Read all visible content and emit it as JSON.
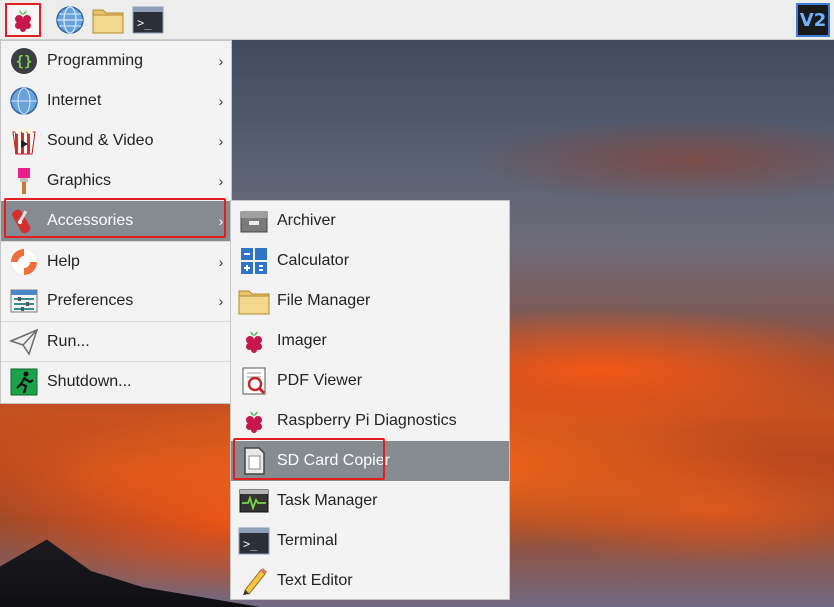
{
  "taskbar": {
    "menu_icon": "raspberry-pi-icon",
    "web_icon": "globe-icon",
    "files_icon": "folder-icon",
    "terminal_icon": "terminal-icon",
    "terminal_glyph": ">_",
    "vnc_text": "V2"
  },
  "main_menu": {
    "items": [
      {
        "label": "Programming",
        "icon": "programming-icon",
        "has_submenu": true
      },
      {
        "label": "Internet",
        "icon": "globe-icon",
        "has_submenu": true
      },
      {
        "label": "Sound & Video",
        "icon": "sound-video-icon",
        "has_submenu": true
      },
      {
        "label": "Graphics",
        "icon": "graphics-icon",
        "has_submenu": true
      },
      {
        "label": "Accessories",
        "icon": "accessories-icon",
        "has_submenu": true,
        "active": true
      },
      {
        "label": "Help",
        "icon": "help-icon",
        "has_submenu": true
      },
      {
        "label": "Preferences",
        "icon": "preferences-icon",
        "has_submenu": true
      },
      {
        "label": "Run...",
        "icon": "run-icon",
        "has_submenu": false
      },
      {
        "label": "Shutdown...",
        "icon": "shutdown-icon",
        "has_submenu": false
      }
    ]
  },
  "sub_menu": {
    "items": [
      {
        "label": "Archiver",
        "icon": "archiver-icon"
      },
      {
        "label": "Calculator",
        "icon": "calculator-icon"
      },
      {
        "label": "File Manager",
        "icon": "folder-icon"
      },
      {
        "label": "Imager",
        "icon": "raspberry-pi-icon"
      },
      {
        "label": "PDF Viewer",
        "icon": "pdf-viewer-icon"
      },
      {
        "label": "Raspberry Pi Diagnostics",
        "icon": "raspberry-pi-icon"
      },
      {
        "label": "SD Card Copier",
        "icon": "sd-card-icon",
        "active": true
      },
      {
        "label": "Task Manager",
        "icon": "task-manager-icon"
      },
      {
        "label": "Terminal",
        "icon": "terminal-icon"
      },
      {
        "label": "Text Editor",
        "icon": "text-editor-icon"
      }
    ]
  },
  "arrow_glyph": "›",
  "colors": {
    "highlight": "#e02020",
    "active_row": "#868b91",
    "menu_bg": "#f3f3f3"
  }
}
